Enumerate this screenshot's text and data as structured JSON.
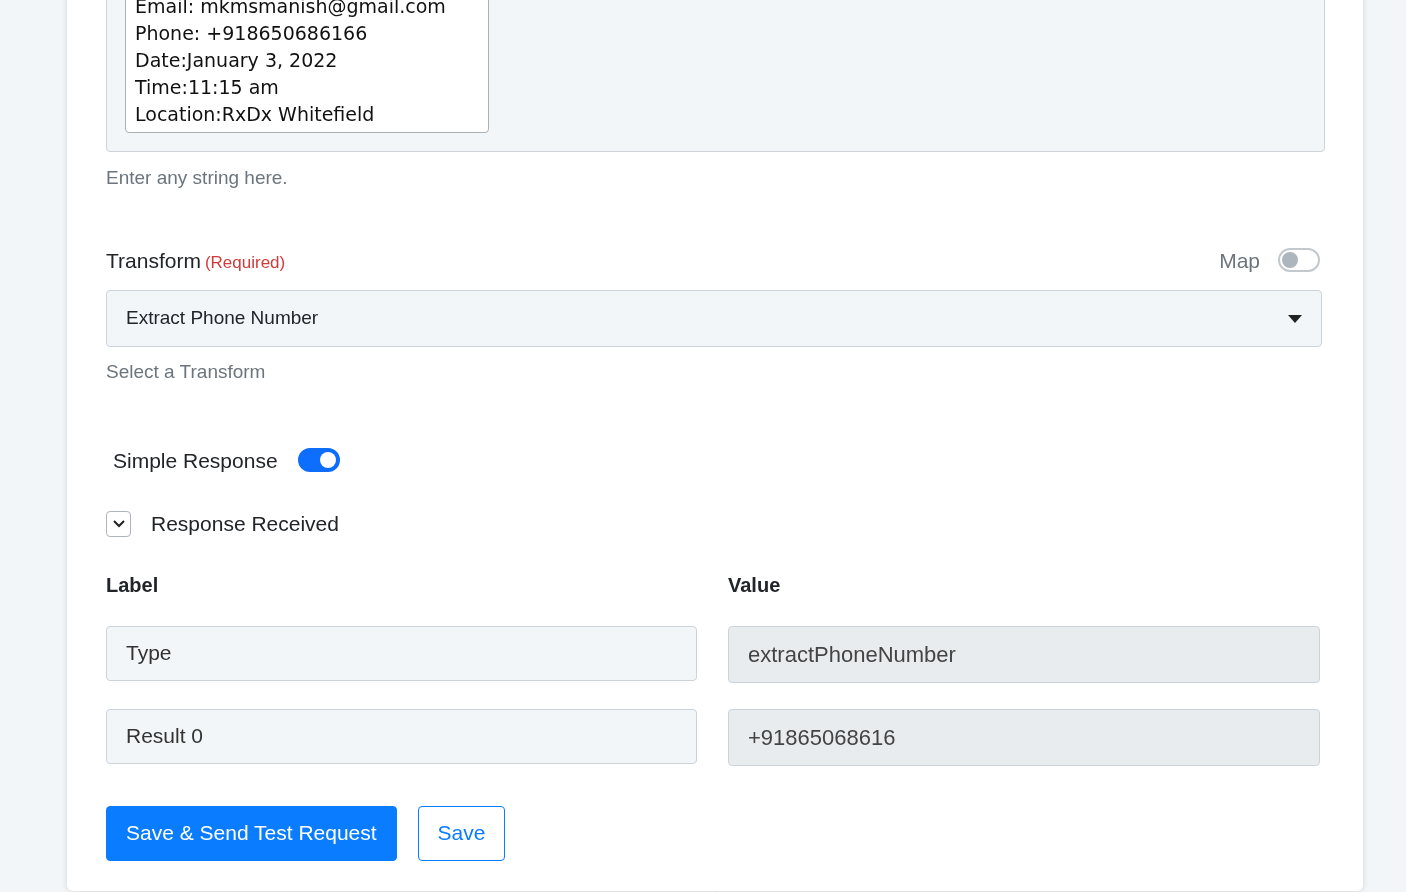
{
  "text_input": {
    "lines": [
      "Email: mkmsmanish@gmail.com",
      "Phone: +918650686166",
      "Date:January 3, 2022",
      "Time:11:15 am",
      "Location:RxDx Whitefield"
    ],
    "help": "Enter any string here."
  },
  "transform": {
    "label": "Transform",
    "required": "(Required)",
    "map_label": "Map",
    "map_on": false,
    "value": "Extract Phone Number",
    "help": "Select a Transform"
  },
  "simple_response": {
    "label": "Simple Response",
    "on": true
  },
  "response": {
    "label": "Response Received",
    "expanded": true,
    "columns": [
      "Label",
      "Value"
    ],
    "rows": [
      {
        "label": "Type",
        "value": "extractPhoneNumber"
      },
      {
        "label": "Result 0",
        "value": "+91865068616"
      }
    ]
  },
  "buttons": [
    {
      "label": "Save & Send Test Request",
      "kind": "primary"
    },
    {
      "label": "Save",
      "kind": "outline"
    }
  ]
}
